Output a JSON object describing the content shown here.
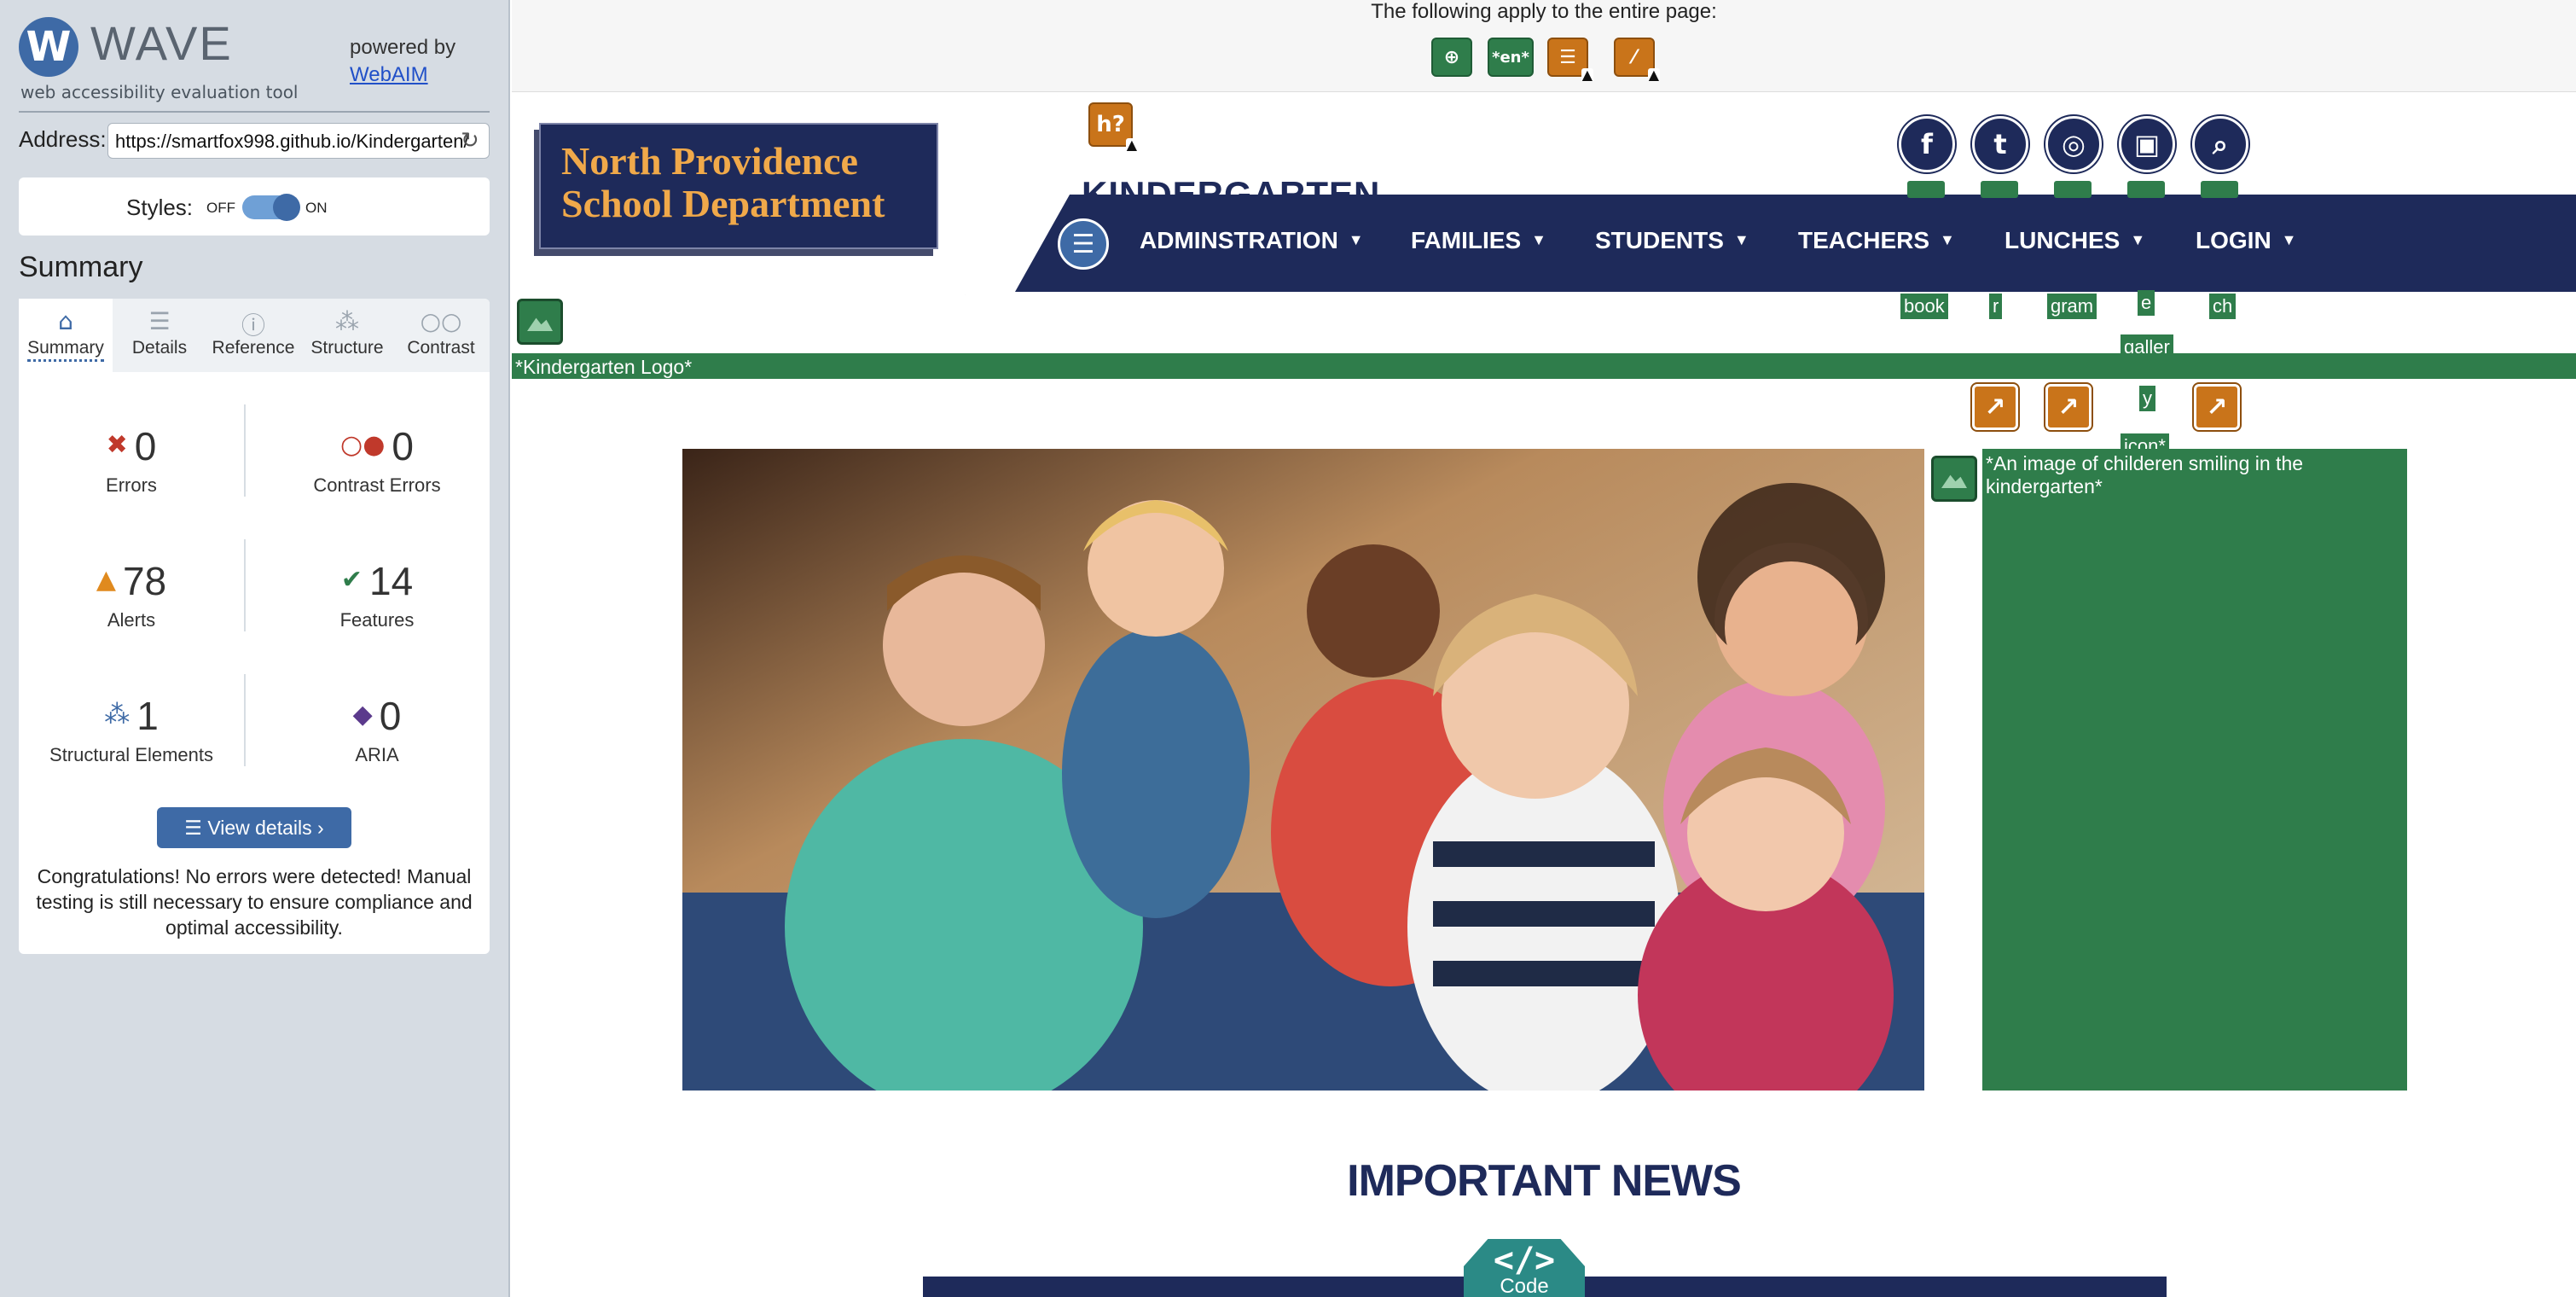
{
  "wave": {
    "logo_letter": "W",
    "name": "WAVE",
    "tagline": "web accessibility evaluation tool",
    "powered_by": "powered by",
    "webaim_link": "WebAIM",
    "address_label": "Address:",
    "address_value": "https://smartfox998.github.io/Kindergarten/",
    "styles_label": "Styles:",
    "styles_off": "OFF",
    "styles_on": "ON",
    "styles_state": "on",
    "summary_heading": "Summary",
    "tabs": [
      {
        "label": "Summary",
        "icon": "home-icon",
        "glyph": "⌂",
        "active": true
      },
      {
        "label": "Details",
        "icon": "list-icon",
        "glyph": "☰",
        "active": false
      },
      {
        "label": "Reference",
        "icon": "info-icon",
        "glyph": "ⓘ",
        "active": false
      },
      {
        "label": "Structure",
        "icon": "structure-icon",
        "glyph": "⁂",
        "active": false
      },
      {
        "label": "Contrast",
        "icon": "contrast-icon",
        "glyph": "○○",
        "active": false
      }
    ],
    "stats": {
      "errors": {
        "value": "0",
        "label": "Errors",
        "glyph": "✖",
        "color": "#c0392b"
      },
      "contrast_errors": {
        "value": "0",
        "label": "Contrast Errors",
        "glyph": "○●",
        "color": "#c0392b"
      },
      "alerts": {
        "value": "78",
        "label": "Alerts",
        "glyph": "▲",
        "color": "#e08a1e"
      },
      "features": {
        "value": "14",
        "label": "Features",
        "glyph": "✔",
        "color": "#2f7d4b"
      },
      "structural": {
        "value": "1",
        "label": "Structural Elements",
        "glyph": "⁂",
        "color": "#3e6aa6"
      },
      "aria": {
        "value": "0",
        "label": "ARIA",
        "glyph": "◆",
        "color": "#5b3a8c"
      }
    },
    "view_details": "View details ›",
    "congrats": "Congratulations! No errors were detected! Manual testing is still necessary to ensure compliance and optimal accessibility."
  },
  "page": {
    "apply_text": "The following apply to the entire page:",
    "page_icons": [
      "language-icon",
      "lang-en-icon",
      "alert-document-icon",
      "alert-noscript-icon"
    ],
    "lang_label": "*en*",
    "help_icon_label": "h?",
    "site_logo_line1": "North Providence",
    "site_logo_line2": "School Department",
    "kinder_title": "KINDERGARTEN",
    "nav": [
      "ADMINSTRATION",
      "FAMILIES",
      "STUDENTS",
      "TEACHERS",
      "LUNCHES",
      "LOGIN"
    ],
    "social_icons": [
      "facebook-icon",
      "twitter-icon",
      "instagram-icon",
      "gallery-icon",
      "search-icon"
    ],
    "social_glyphs": [
      "f",
      "t",
      "◎",
      "▣",
      "⌕"
    ],
    "social_tags": {
      "book": "book",
      "r": "r",
      "gram": "gram",
      "e": "e",
      "ch": "ch",
      "galler": "galler",
      "y": "y",
      "icon": "icon*"
    },
    "alt_logo": "*Kindergarten Logo*",
    "hero_alt": "*An image of childeren smiling in the kindergarten*",
    "news_heading": "IMPORTANT NEWS",
    "code_badge_symbol": "</>",
    "code_badge_label": "Code"
  },
  "colors": {
    "navy": "#1e2a5a",
    "wave_blue": "#3e6aa6",
    "feature_green": "#2f7d4b",
    "alert_orange": "#c9741a",
    "logo_gold": "#f0a94a"
  }
}
